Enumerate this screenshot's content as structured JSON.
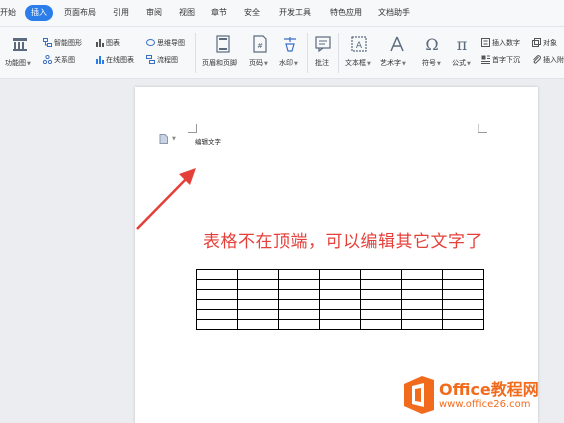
{
  "menubar": {
    "tabs": [
      {
        "label": "开始"
      },
      {
        "label": "插入"
      },
      {
        "label": "页面布局"
      },
      {
        "label": "引用"
      },
      {
        "label": "审阅"
      },
      {
        "label": "视图"
      },
      {
        "label": "章节"
      },
      {
        "label": "安全"
      },
      {
        "label": "开发工具"
      },
      {
        "label": "特色应用"
      },
      {
        "label": "文档助手"
      }
    ],
    "active_tab": "插入"
  },
  "ribbon": {
    "function_chart": "功能图",
    "smart_art": "智能图形",
    "chart": "图表",
    "mind_map": "思维导图",
    "relation_chart": "关系图",
    "online_chart": "在线图表",
    "flowchart": "流程图",
    "header_footer": "页眉和页脚",
    "page_number": "页码",
    "watermark": "水印",
    "comment": "批注",
    "text_box": "文本框",
    "art_text": "艺术字",
    "symbol": "符号",
    "formula": "公式",
    "insert_number": "插入数字",
    "object": "对象",
    "drop_cap": "首字下沉",
    "insert_attachment": "插入附"
  },
  "document": {
    "header_text": "编辑文字",
    "annotation": "表格不在顶端，可以编辑其它文字了",
    "table": {
      "rows": 6,
      "cols": 7
    }
  },
  "watermark": {
    "title": "Office教程网",
    "url": "www.office26.com"
  },
  "colors": {
    "accent": "#2b7de9",
    "annotation": "#e53f3a",
    "watermark": "#f26b1d"
  }
}
